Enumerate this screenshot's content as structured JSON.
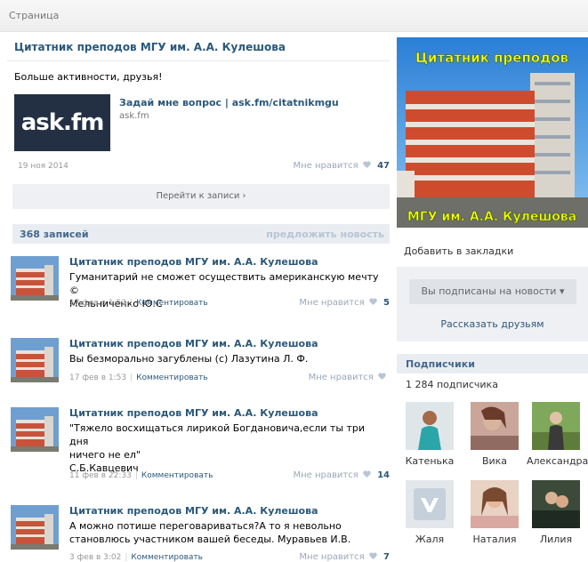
{
  "topbar": {
    "crumb": "Страница"
  },
  "pinned": {
    "title": "Цитатник преподов МГУ им. А.А. Кулешова",
    "text": "Больше активности, друзья!",
    "logo_text": "ask.fm",
    "link_title": "Задай мне вопрос | ask.fm/citatnikmgu",
    "link_domain": "ask.fm",
    "date": "19 ноя 2014",
    "like_label": "Мне нравится",
    "like_count": "47",
    "goto_label": "Перейти к записи ›"
  },
  "wall": {
    "count": "368 записей",
    "suggest": "предложить новость"
  },
  "posts": [
    {
      "author": "Цитатник преподов МГУ им. А.А. Кулешова",
      "lines": [
        "Гуманитарий не сможет осуществить американскую мечту ©",
        "Мельниченко Ю.С"
      ],
      "date": "17 фев в 1:53",
      "comment": "Комментировать",
      "like_label": "Мне нравится",
      "like_count": "5"
    },
    {
      "author": "Цитатник преподов МГУ им. А.А. Кулешова",
      "lines": [
        "Вы безморально загублены (с) Лазутина Л. Ф."
      ],
      "date": "17 фев в 1:53",
      "comment": "Комментировать",
      "like_label": "Мне нравится",
      "like_count": ""
    },
    {
      "author": "Цитатник преподов МГУ им. А.А. Кулешова",
      "lines": [
        "\"Тяжело восхищаться лирикой Богдановича,если ты три дня",
        "ничего не ел\"",
        "С.Б.Кавцевич"
      ],
      "date": "11 фев в 22:33",
      "comment": "Комментировать",
      "like_label": "Мне нравится",
      "like_count": "14"
    },
    {
      "author": "Цитатник преподов МГУ им. А.А. Кулешова",
      "lines": [
        "А можно потише переговариваться?А то я невольно",
        "становлюсь участником вашей беседы. Муравьев И.В."
      ],
      "date": "3 фев в 3:02",
      "comment": "Комментировать",
      "like_label": "Мне нравится",
      "like_count": "7"
    }
  ],
  "sidebar": {
    "cover_top_text": "Цитатник преподов",
    "cover_bottom_text": "МГУ им. А.А. Кулешова",
    "bookmark": "Добавить в закладки",
    "subscribed_btn": "Вы подписаны на новости ▾",
    "tell_friends": "Рассказать друзьям",
    "subscribers_title": "Подписчики",
    "subscribers_count": "1 284 подписчика",
    "subscribers": [
      {
        "name": "Катенька"
      },
      {
        "name": "Вика"
      },
      {
        "name": "Александра"
      },
      {
        "name": "Жаля"
      },
      {
        "name": "Наталия"
      },
      {
        "name": "Лилия"
      }
    ]
  },
  "colors": {
    "link": "#2b587a",
    "header_bg": "#e9edf1",
    "cover_text": "#ffff00",
    "askfm_bg": "#233043"
  }
}
